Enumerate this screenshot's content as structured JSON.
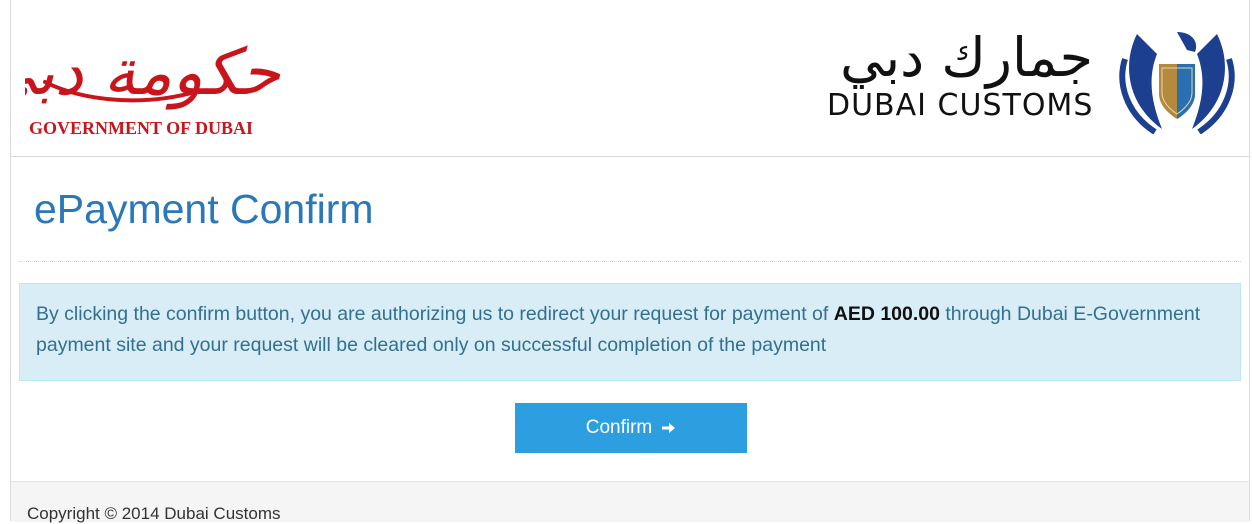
{
  "header": {
    "gov_logo": {
      "arabic": "حكومة دبي",
      "text": "GOVERNMENT OF DUBAI"
    },
    "customs_logo": {
      "arabic": "جمارك دبي",
      "text": "DUBAI CUSTOMS"
    }
  },
  "page": {
    "title": "ePayment Confirm"
  },
  "notice": {
    "before_amount": "By clicking the confirm button, you are authorizing us to redirect your request for payment of ",
    "amount": "AED 100.00",
    "after_amount": " through Dubai E-Government payment site and your request will be cleared only on successful completion of the payment"
  },
  "actions": {
    "confirm_label": "Confirm",
    "confirm_icon": "arrow-right-icon"
  },
  "footer": {
    "copyright": "Copyright © 2014 Dubai Customs"
  },
  "colors": {
    "title": "#2b78b8",
    "alert_bg": "#d9edf7",
    "alert_text": "#31708f",
    "button": "#2d9fe0",
    "gov_red": "#c8151b",
    "eagle_blue": "#1c3f8f",
    "eagle_gold": "#b58a3c"
  }
}
